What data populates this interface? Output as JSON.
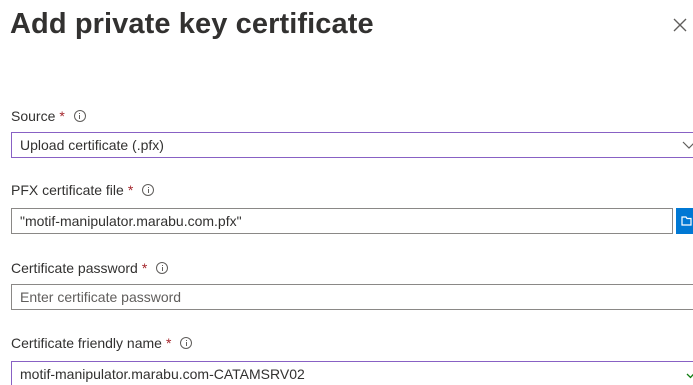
{
  "dialog": {
    "title": "Add private key certificate",
    "close_icon": "close-icon"
  },
  "fields": {
    "source": {
      "label": "Source",
      "required_mark": "*",
      "value": "Upload certificate (.pfx)"
    },
    "pfx_file": {
      "label": "PFX certificate file",
      "required_mark": "*",
      "value": "\"motif-manipulator.marabu.com.pfx\"",
      "browse_icon": "folder-icon"
    },
    "password": {
      "label": "Certificate password",
      "required_mark": "*",
      "placeholder": "Enter certificate password",
      "value": ""
    },
    "friendly_name": {
      "label": "Certificate friendly name",
      "required_mark": "*",
      "value": "motif-manipulator.marabu.com-CATAMSRV02",
      "valid_icon": "checkmark-icon"
    }
  },
  "colors": {
    "accent_border": "#8861c4",
    "required": "#a4262c",
    "primary_button": "#0078d4",
    "valid_check": "#107c10"
  }
}
